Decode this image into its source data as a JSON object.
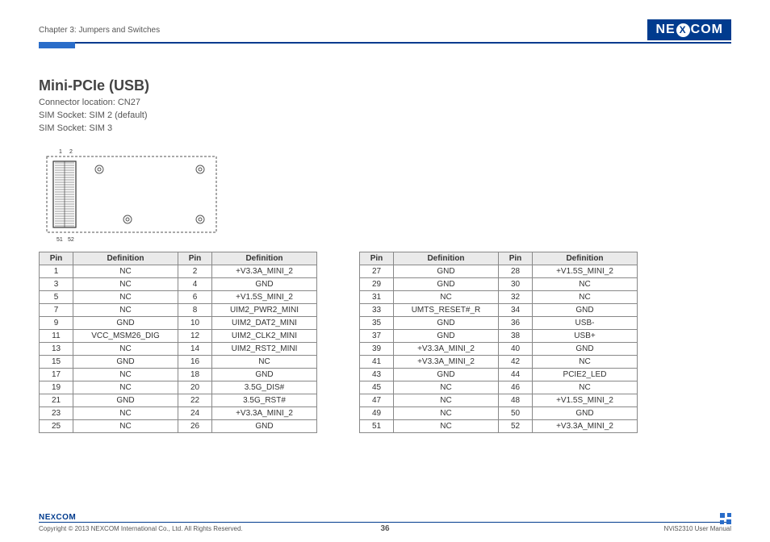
{
  "header": {
    "chapter": "Chapter 3: Jumpers and Switches",
    "logo_pre": "NE",
    "logo_x": "X",
    "logo_post": "COM"
  },
  "section": {
    "title": "Mini-PCIe (USB)",
    "meta1": "Connector location: CN27",
    "meta2": "SIM Socket: SIM 2 (default)",
    "meta3": "SIM Socket: SIM 3"
  },
  "diagram": {
    "pin1": "1",
    "pin2": "2",
    "pin51": "51",
    "pin52": "52"
  },
  "table_headers": {
    "pin": "Pin",
    "def": "Definition"
  },
  "chart_data": {
    "type": "table",
    "title": "Mini-PCIe (USB) Pin Definitions",
    "columns": [
      "Pin",
      "Definition",
      "Pin",
      "Definition"
    ],
    "rows_left": [
      [
        "1",
        "NC",
        "2",
        "+V3.3A_MINI_2"
      ],
      [
        "3",
        "NC",
        "4",
        "GND"
      ],
      [
        "5",
        "NC",
        "6",
        "+V1.5S_MINI_2"
      ],
      [
        "7",
        "NC",
        "8",
        "UIM2_PWR2_MINI"
      ],
      [
        "9",
        "GND",
        "10",
        "UIM2_DAT2_MINI"
      ],
      [
        "11",
        "VCC_MSM26_DIG",
        "12",
        "UIM2_CLK2_MINI"
      ],
      [
        "13",
        "NC",
        "14",
        "UIM2_RST2_MINI"
      ],
      [
        "15",
        "GND",
        "16",
        "NC"
      ],
      [
        "17",
        "NC",
        "18",
        "GND"
      ],
      [
        "19",
        "NC",
        "20",
        "3.5G_DIS#"
      ],
      [
        "21",
        "GND",
        "22",
        "3.5G_RST#"
      ],
      [
        "23",
        "NC",
        "24",
        "+V3.3A_MINI_2"
      ],
      [
        "25",
        "NC",
        "26",
        "GND"
      ]
    ],
    "rows_right": [
      [
        "27",
        "GND",
        "28",
        "+V1.5S_MINI_2"
      ],
      [
        "29",
        "GND",
        "30",
        "NC"
      ],
      [
        "31",
        "NC",
        "32",
        "NC"
      ],
      [
        "33",
        "UMTS_RESET#_R",
        "34",
        "GND"
      ],
      [
        "35",
        "GND",
        "36",
        "USB-"
      ],
      [
        "37",
        "GND",
        "38",
        "USB+"
      ],
      [
        "39",
        "+V3.3A_MINI_2",
        "40",
        "GND"
      ],
      [
        "41",
        "+V3.3A_MINI_2",
        "42",
        "NC"
      ],
      [
        "43",
        "GND",
        "44",
        "PCIE2_LED"
      ],
      [
        "45",
        "NC",
        "46",
        "NC"
      ],
      [
        "47",
        "NC",
        "48",
        "+V1.5S_MINI_2"
      ],
      [
        "49",
        "NC",
        "50",
        "GND"
      ],
      [
        "51",
        "NC",
        "52",
        "+V3.3A_MINI_2"
      ]
    ]
  },
  "footer": {
    "logo_pre": "NE",
    "logo_x": "X",
    "logo_post": "COM",
    "copyright": "Copyright © 2013 NEXCOM International Co., Ltd. All Rights Reserved.",
    "page": "36",
    "doc": "NViS2310 User Manual"
  }
}
